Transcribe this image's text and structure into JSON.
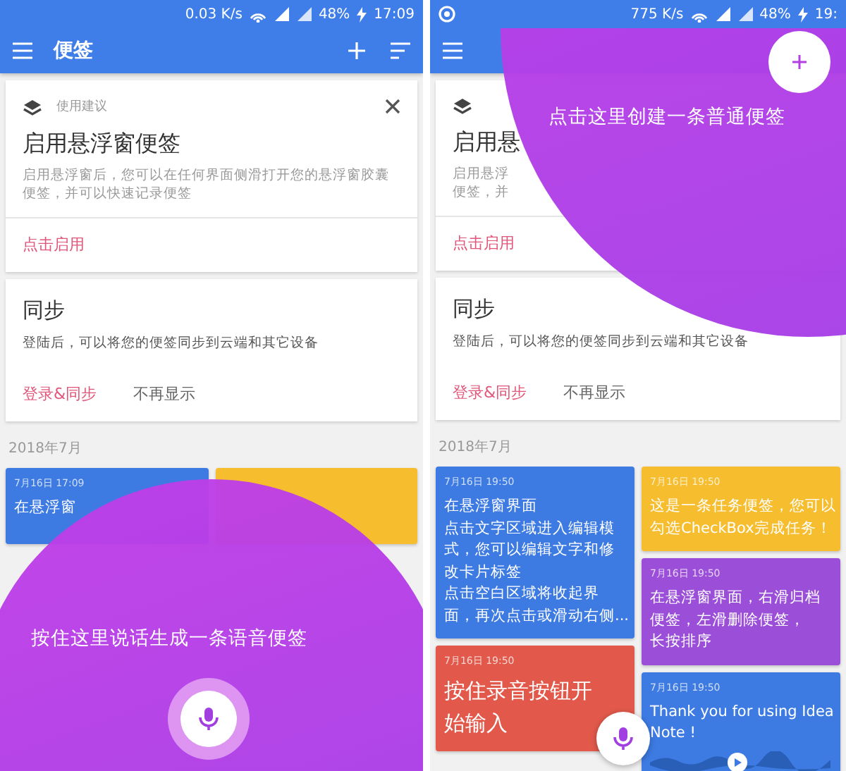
{
  "screens": [
    {
      "status_bar": {
        "speed": "0.03 K/s",
        "battery": "48%",
        "time": "17:09"
      },
      "app_bar": {
        "title": "便签"
      },
      "tip_card": {
        "caption": "使用建议",
        "title": "启用悬浮窗便签",
        "lines": [
          "启用悬浮窗后，您可以在任何界面侧滑打开您的悬浮窗胶囊",
          "便签，并可以快速记录便签"
        ],
        "action": "点击启用"
      },
      "sync_card": {
        "title": "同步",
        "text": "登陆后，可以将您的便签同步到云端和其它设备",
        "actions": [
          {
            "label": "登录&同步",
            "kind": "primary"
          },
          {
            "label": "不再显示",
            "kind": "plain"
          }
        ]
      },
      "month": "2018年7月",
      "note_columns": [
        [
          {
            "kind": "text",
            "color": "#3d7be3",
            "date": "7月16日 17:09",
            "lines": [
              "在悬浮窗"
            ]
          }
        ],
        [
          {
            "kind": "text",
            "color": "#f6bd2e"
          }
        ]
      ],
      "overlay": {
        "kind": "voice",
        "hint": "按住这里说话生成一条语音便签"
      }
    },
    {
      "status_bar": {
        "notification_icon": true,
        "speed": "775 K/s",
        "battery": "48%",
        "time": "19:"
      },
      "tip_card": {
        "title": "启用悬",
        "lines": [
          "启用悬浮",
          "便签，并"
        ],
        "action": "点击启用"
      },
      "sync_card": {
        "title": "同步",
        "text": "登陆后，可以将您的便签同步到云端和其它设备",
        "actions": [
          {
            "label": "登录&同步",
            "kind": "primary"
          },
          {
            "label": "不再显示",
            "kind": "plain"
          }
        ]
      },
      "month": "2018年7月",
      "note_columns": [
        [
          {
            "kind": "text",
            "color": "#3d7be3",
            "date": "7月16日 19:50",
            "lines": [
              "在悬浮窗界面",
              "点击文字区域进入编辑模",
              "式，您可以编辑文字和修",
              "改卡片标签",
              "点击空白区域将收起界",
              "面，再次点击或滑动右侧..."
            ]
          },
          {
            "kind": "large",
            "color": "#e2594b",
            "date": "7月16日 19:50",
            "lines": [
              "按住录音按钮开",
              "始输入"
            ]
          }
        ],
        [
          {
            "kind": "text",
            "color": "#f6bd2e",
            "date": "7月16日 19:50",
            "lines": [
              "这是一条任务便签，您可以",
              "勾选CheckBox完成任务！"
            ]
          },
          {
            "kind": "text",
            "color": "#9b4fd9",
            "date": "7月16日 19:50",
            "lines": [
              "在悬浮窗界面，右滑归档",
              "便签，左滑删除便签，",
              "长按排序"
            ]
          },
          {
            "kind": "audio",
            "color": "#3d7be3",
            "date": "7月16日 19:50",
            "lines": [
              "Thank you for using Idea",
              "Note !"
            ]
          }
        ]
      ],
      "overlay": {
        "kind": "create",
        "hint": "点击这里创建一条普通便签"
      }
    }
  ]
}
